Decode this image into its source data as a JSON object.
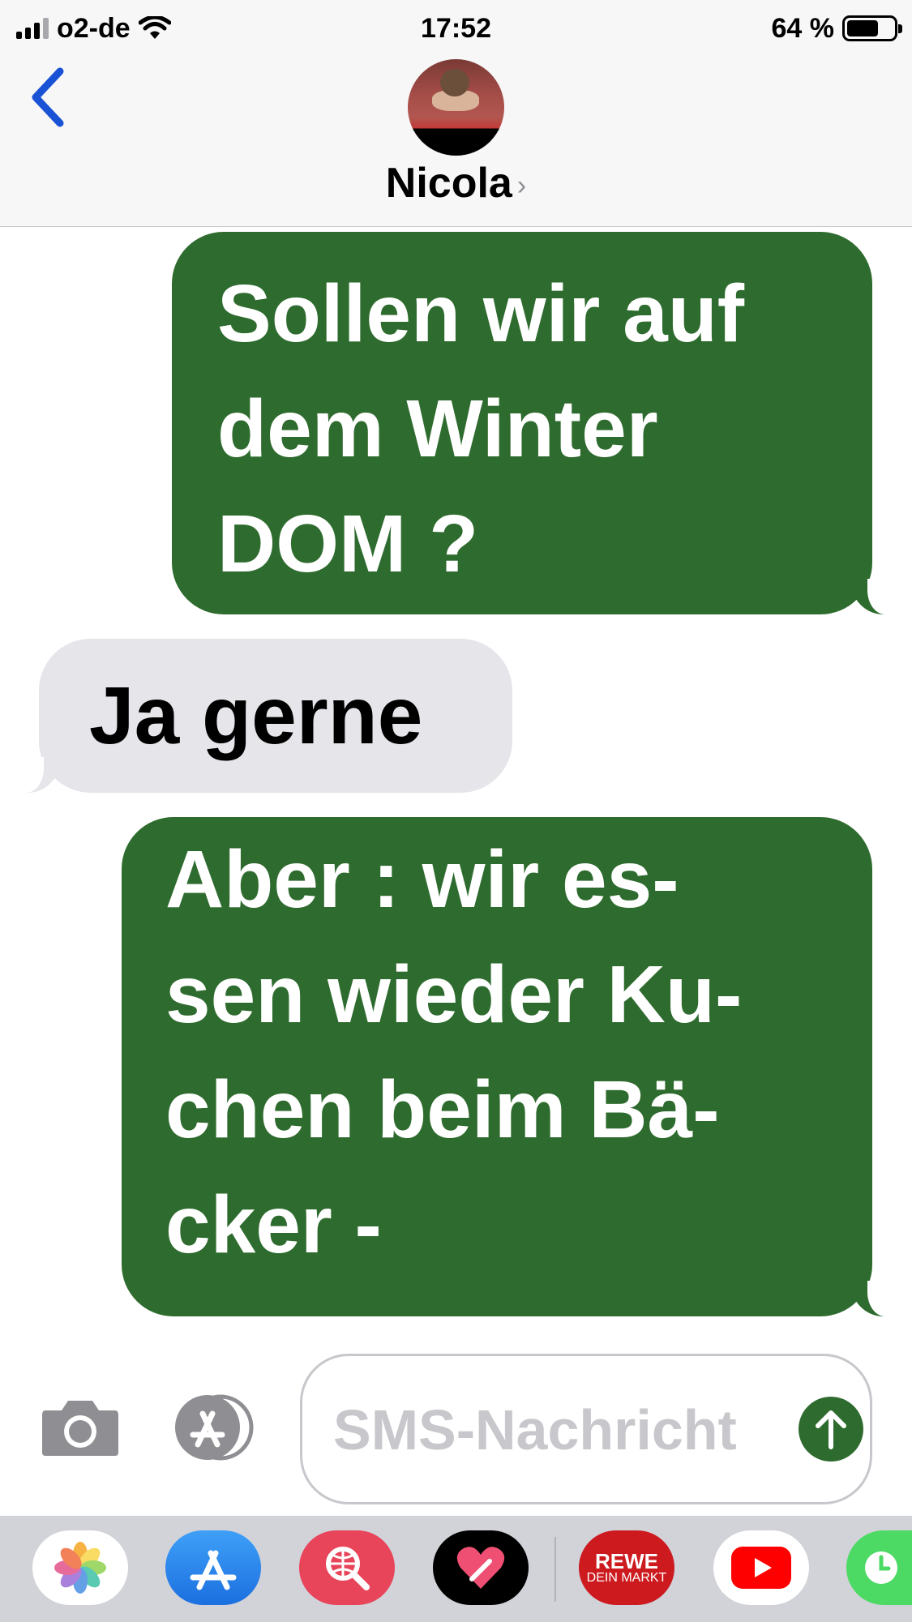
{
  "status_bar": {
    "carrier": "o2-de",
    "time": "17:52",
    "battery_percent": "64 %",
    "battery_level": 0.64,
    "signal_bars": 3,
    "signal_bars_total": 4
  },
  "header": {
    "contact_name": "Nicola",
    "contact_chevron": "›"
  },
  "messages": [
    {
      "direction": "outgoing",
      "lines": [
        "Sollen wir auf",
        "dem Winter",
        "DOM ?"
      ]
    },
    {
      "direction": "incoming",
      "lines": [
        "Ja gerne"
      ]
    },
    {
      "direction": "outgoing",
      "lines": [
        "Aber : wir es-",
        "sen wieder Ku-",
        "chen beim Bä-",
        "cker -"
      ]
    }
  ],
  "composer": {
    "placeholder": "SMS-Nachricht",
    "value": ""
  },
  "app_drawer": {
    "apps": [
      "photos-icon",
      "app-store-icon",
      "web-search-icon",
      "heart-sticker-icon",
      "rewe-icon",
      "youtube-icon",
      "clock-icon"
    ],
    "rewe_text_1": "REWE",
    "rewe_text_2": "DEIN MARKT"
  },
  "colors": {
    "outgoing_bubble": "#2e6b2e",
    "incoming_bubble": "#e5e5ea",
    "accent_blue": "#1a52d6",
    "placeholder": "#c7c7cc"
  }
}
